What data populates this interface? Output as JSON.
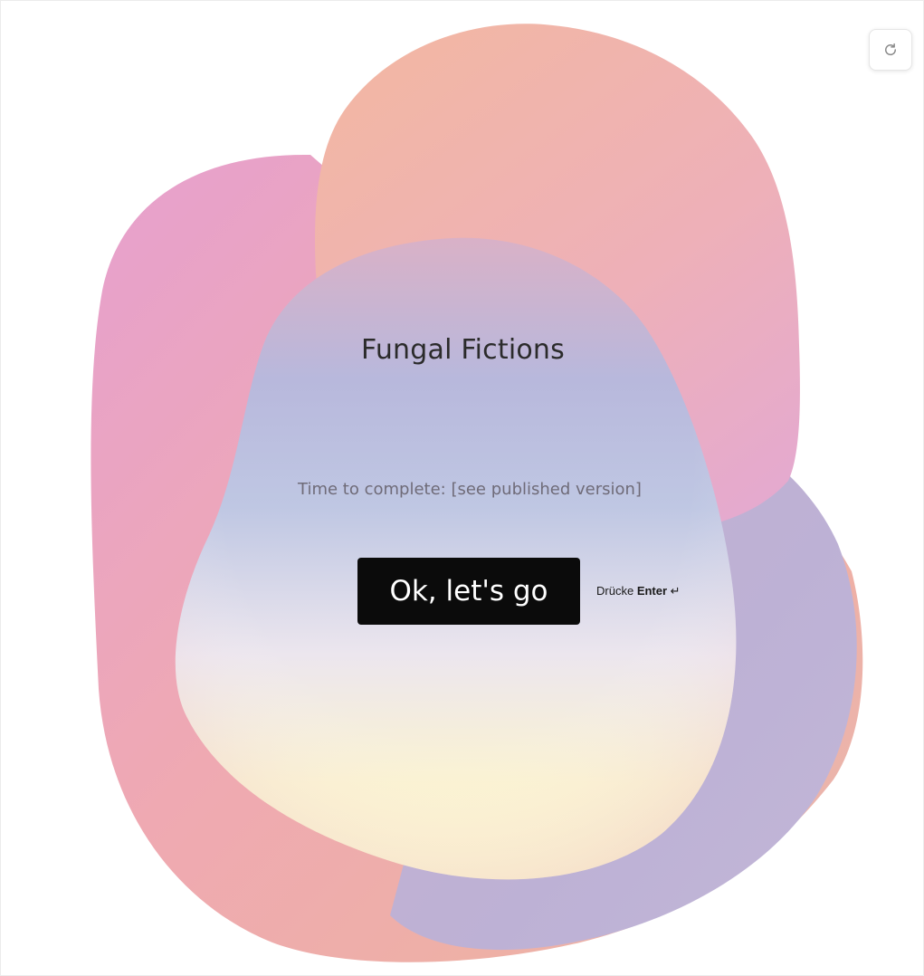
{
  "welcome": {
    "title": "Fungal Fictions",
    "time_to_complete": "Time to complete: [see published version]"
  },
  "cta": {
    "button_label": "Ok, let's go",
    "hint_prefix": "Drücke",
    "hint_key": "Enter",
    "hint_symbol": "↵"
  },
  "toolbar": {
    "refresh_icon": "refresh-icon"
  },
  "colors": {
    "button_bg": "#0b0b0b",
    "button_text": "#ffffff",
    "blob_pink": "#e9a2c9",
    "blob_peach": "#efb5a6",
    "blob_lavender": "#bab3d6",
    "blob_cream": "#fbf3cf"
  }
}
